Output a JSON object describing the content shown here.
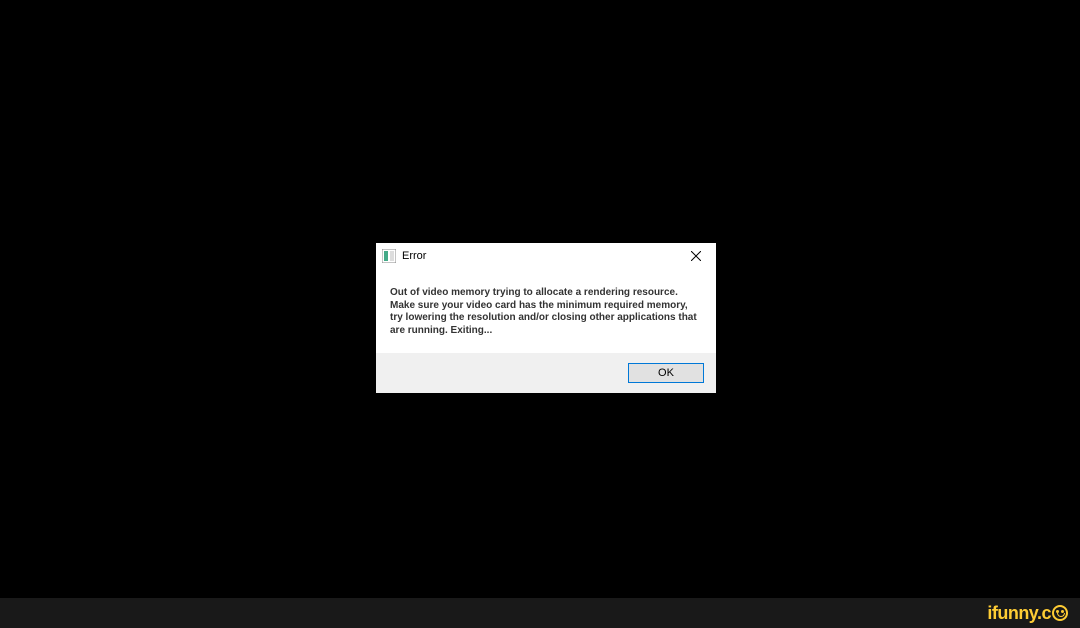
{
  "dialog": {
    "title": "Error",
    "message": "Out of video memory trying to allocate a rendering resource. Make sure your video card has the minimum required memory, try lowering the resolution and/or closing other applications that are running. Exiting...",
    "ok_label": "OK"
  },
  "watermark": {
    "text": "ifunny.c"
  }
}
